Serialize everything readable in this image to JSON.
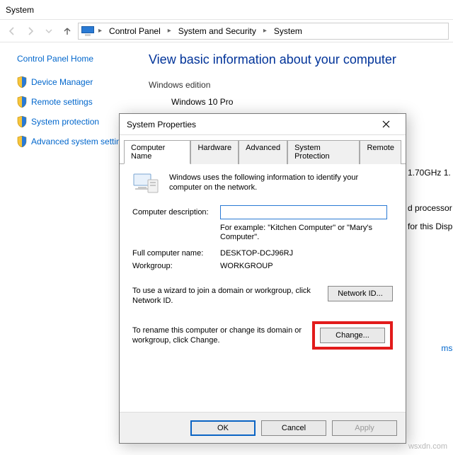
{
  "window_title": "System",
  "breadcrumb": {
    "root": "Control Panel",
    "mid": "System and Security",
    "leaf": "System"
  },
  "sidebar": {
    "home": "Control Panel Home",
    "items": [
      "Device Manager",
      "Remote settings",
      "System protection",
      "Advanced system settings"
    ]
  },
  "main": {
    "heading": "View basic information about your computer",
    "edition_label": "Windows edition",
    "edition_value": "Windows 10 Pro"
  },
  "peek": {
    "cpu": "1.70GHz   1.",
    "proc": "d processor",
    "disp": "for this Disp",
    "ms": "ms"
  },
  "dialog": {
    "title": "System Properties",
    "tabs": [
      "Computer Name",
      "Hardware",
      "Advanced",
      "System Protection",
      "Remote"
    ],
    "intro": "Windows uses the following information to identify your computer on the network.",
    "desc_label": "Computer description:",
    "desc_value": "",
    "example": "For example: \"Kitchen Computer\" or \"Mary's Computer\".",
    "fullname_label": "Full computer name:",
    "fullname_value": "DESKTOP-DCJ96RJ",
    "workgroup_label": "Workgroup:",
    "workgroup_value": "WORKGROUP",
    "wizard_text": "To use a wizard to join a domain or workgroup, click Network ID.",
    "networkid_btn": "Network ID...",
    "rename_text": "To rename this computer or change its domain or workgroup, click Change.",
    "change_btn": "Change...",
    "ok_btn": "OK",
    "cancel_btn": "Cancel",
    "apply_btn": "Apply"
  },
  "watermark": "wsxdn.com"
}
